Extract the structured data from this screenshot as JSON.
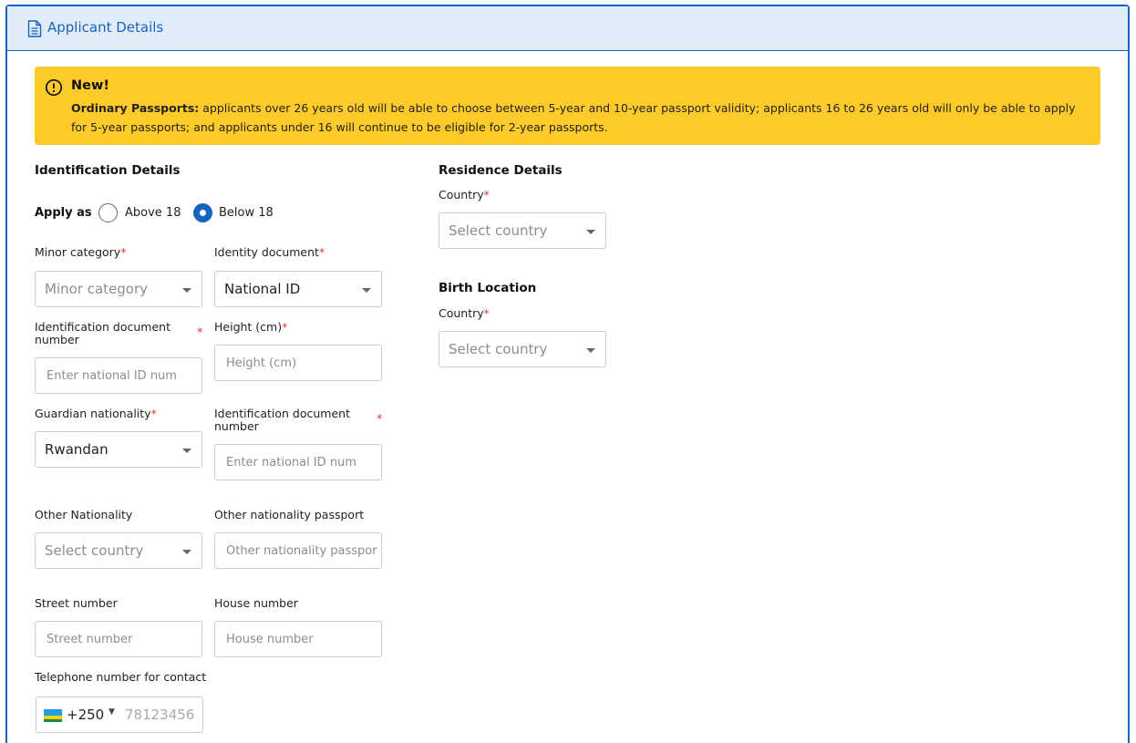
{
  "header": {
    "title": "Applicant Details",
    "icon": "document-icon"
  },
  "notice": {
    "label": "New!",
    "strong": "Ordinary Passports:",
    "text": " applicants over 26 years old will be able to choose between 5-year and 10-year passport validity; applicants 16 to 26 years old will only be able to apply for 5-year passports; and applicants under 16 will continue to be eligible for 2-year passports.",
    "color": "#ffcb2b"
  },
  "identification": {
    "title": "Identification Details",
    "apply_as_label": "Apply as",
    "options": [
      {
        "label": "Above 18",
        "selected": false
      },
      {
        "label": "Below 18",
        "selected": true
      }
    ],
    "minor_category": {
      "label": "Minor category",
      "placeholder": "Minor category"
    },
    "identity_document": {
      "label": "Identity document",
      "value": "National ID"
    },
    "id_doc_number": {
      "label": "Identification document number",
      "placeholder": "Enter national ID num"
    },
    "height": {
      "label": "Height (cm)",
      "placeholder": "Height (cm)"
    },
    "guardian_nationality": {
      "label": "Guardian nationality",
      "value": "Rwandan"
    },
    "guardian_id_doc_number": {
      "label": "Identification document number",
      "placeholder": "Enter national ID num"
    },
    "other_nationality": {
      "label": "Other Nationality",
      "placeholder": "Select country"
    },
    "other_passport": {
      "label": "Other nationality passport",
      "placeholder": "Other nationality passpor"
    },
    "street_number": {
      "label": "Street number",
      "placeholder": "Street number"
    },
    "house_number": {
      "label": "House number",
      "placeholder": "House number"
    },
    "telephone": {
      "label": "Telephone number for contact",
      "code": "+250",
      "placeholder": "78123456",
      "flag": "rwanda-flag"
    }
  },
  "residence": {
    "title": "Residence Details",
    "country": {
      "label": "Country",
      "placeholder": "Select country"
    }
  },
  "birth": {
    "title": "Birth Location",
    "country": {
      "label": "Country",
      "placeholder": "Select country"
    }
  },
  "required_mark": "*",
  "colors": {
    "accent": "#1565c0",
    "header_bg": "#e2ecf8",
    "required": "#e53935"
  }
}
